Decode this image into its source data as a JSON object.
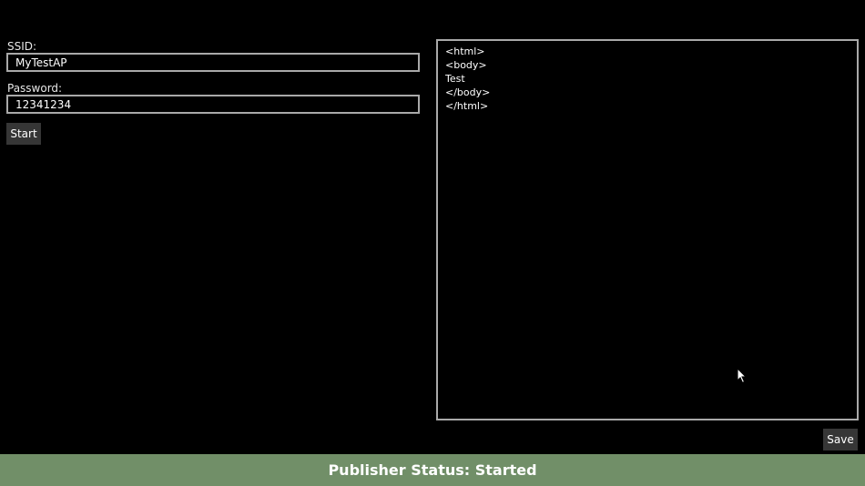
{
  "form": {
    "ssid_label": "SSID:",
    "ssid_value": "MyTestAP",
    "password_label": "Password:",
    "password_value": "12341234",
    "start_label": "Start"
  },
  "editor": {
    "content": "<html>\n<body>\nTest\n</body>\n</html>"
  },
  "save_label": "Save",
  "status": {
    "text": "Publisher Status: Started"
  },
  "colors": {
    "background": "#000000",
    "status_bar": "#718f68",
    "button": "#363636",
    "border": "#a9a9a9"
  },
  "icons": {
    "cursor": "mouse-pointer-icon"
  }
}
